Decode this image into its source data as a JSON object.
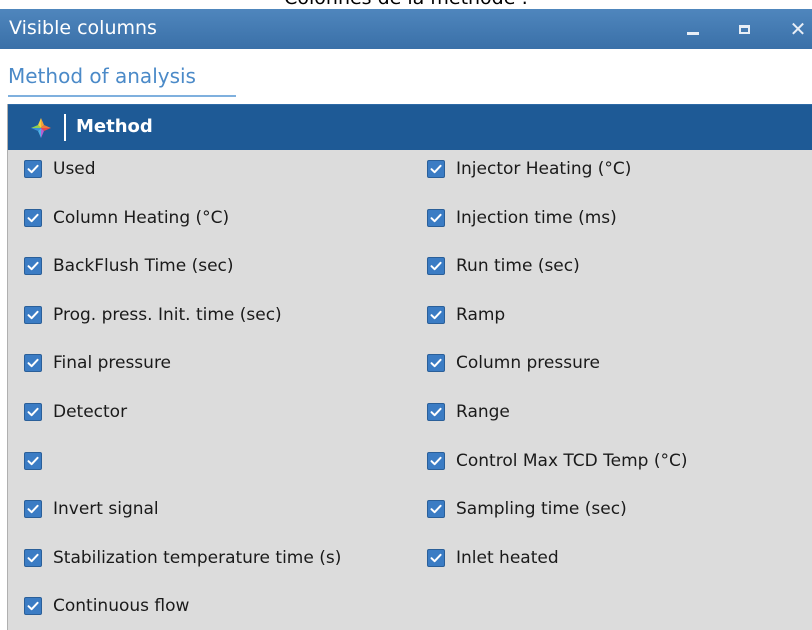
{
  "document": {
    "heading": "Colonnes de la méthode :"
  },
  "window": {
    "title": "Visible columns",
    "controls": {
      "minimize": "–",
      "maximize": "☐",
      "close": "✕"
    }
  },
  "tab": {
    "label": "Method of analysis"
  },
  "panel": {
    "header": "Method",
    "icon": "method-logo-icon"
  },
  "columns": {
    "left": [
      {
        "label": "Used",
        "checked": true
      },
      {
        "label": "Column Heating (°C)",
        "checked": true
      },
      {
        "label": "BackFlush Time (sec)",
        "checked": true
      },
      {
        "label": "Prog. press. Init. time (sec)",
        "checked": true
      },
      {
        "label": "Final pressure",
        "checked": true
      },
      {
        "label": "Detector",
        "checked": true
      },
      {
        "label": "",
        "checked": true
      },
      {
        "label": "Invert signal",
        "checked": true
      },
      {
        "label": "Stabilization temperature time (s)",
        "checked": true
      },
      {
        "label": "Continuous flow",
        "checked": true
      }
    ],
    "right": [
      {
        "label": "Injector Heating (°C)",
        "checked": true
      },
      {
        "label": "Injection time (ms)",
        "checked": true
      },
      {
        "label": "Run time (sec)",
        "checked": true
      },
      {
        "label": "Ramp",
        "checked": true
      },
      {
        "label": "Column pressure",
        "checked": true
      },
      {
        "label": "Range",
        "checked": true
      },
      {
        "label": "Control Max TCD Temp (°C)",
        "checked": true
      },
      {
        "label": "Sampling time (sec)",
        "checked": true
      },
      {
        "label": "Inlet heated",
        "checked": true
      }
    ]
  },
  "colors": {
    "titlebar": "#3f76ad",
    "panel_header": "#1e5a96",
    "panel_bg": "#dcdcdc",
    "checkbox": "#3b7cc4",
    "tab_text": "#4b8ac8"
  }
}
